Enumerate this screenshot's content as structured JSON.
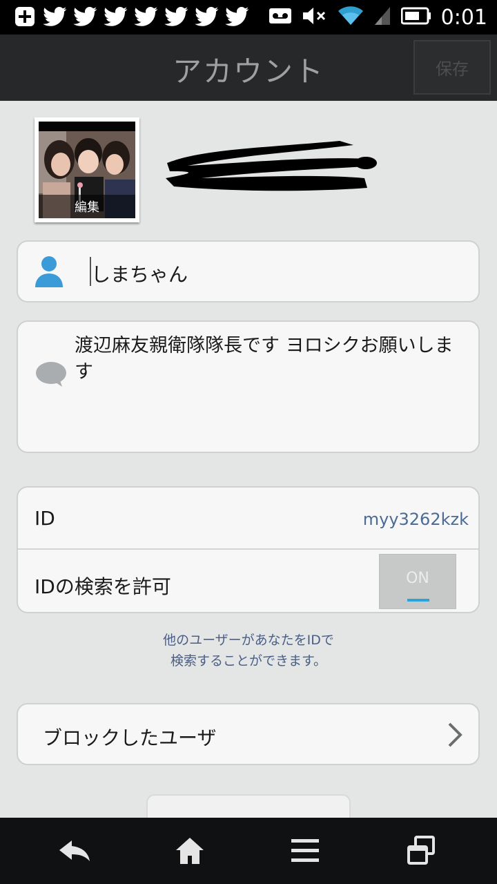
{
  "status_bar": {
    "time": "0:01",
    "icons": [
      "add-icon",
      "twitter-icon",
      "twitter-icon",
      "twitter-icon",
      "twitter-icon",
      "twitter-icon",
      "twitter-icon",
      "twitter-icon",
      "voicemail-icon",
      "mute-icon",
      "wifi-icon",
      "signal-icon",
      "battery-icon"
    ]
  },
  "app_bar": {
    "title": "アカウント",
    "save_label": "保存"
  },
  "profile": {
    "avatar_edit_label": "編集",
    "name_redacted": true
  },
  "name_field": {
    "value": "しまちゃん",
    "icon": "person-icon"
  },
  "status_message": {
    "value": "渡辺麻友親衛隊隊長です ヨロシクお願いします",
    "icon": "speech-bubble-icon"
  },
  "id_section": {
    "id_label": "ID",
    "id_value": "myy3262kzk",
    "allow_search_label": "IDの検索を許可",
    "toggle_state": "ON"
  },
  "hint": {
    "line1": "他のユーザーがあなたをIDで",
    "line2": "検索することができます。"
  },
  "blocked": {
    "label": "ブロックしたユーザ"
  },
  "nav_bar": {
    "icons": [
      "back-icon",
      "home-icon",
      "menu-icon",
      "recent-apps-icon"
    ]
  },
  "colors": {
    "background": "#e4e6e6",
    "app_bar": "#262829",
    "accent": "#2aa4d8",
    "link": "#4a6b95"
  }
}
